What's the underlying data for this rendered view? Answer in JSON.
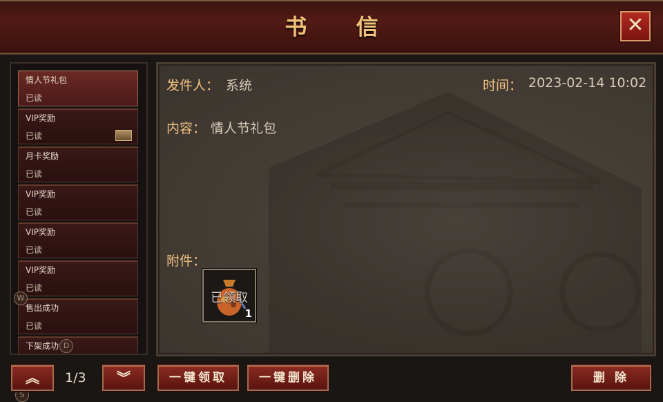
{
  "window": {
    "title": "书 信",
    "close_label": "✕"
  },
  "mail_list": [
    {
      "subject": "情人节礼包",
      "status": "已读",
      "selected": true,
      "has_attachment": false
    },
    {
      "subject": "VIP奖励",
      "status": "已读",
      "selected": false,
      "has_attachment": true
    },
    {
      "subject": "月卡奖励",
      "status": "已读",
      "selected": false,
      "has_attachment": false
    },
    {
      "subject": "VIP奖励",
      "status": "已读",
      "selected": false,
      "has_attachment": false
    },
    {
      "subject": "VIP奖励",
      "status": "已读",
      "selected": false,
      "has_attachment": false
    },
    {
      "subject": "VIP奖励",
      "status": "已读",
      "selected": false,
      "has_attachment": false
    },
    {
      "subject": "售出成功",
      "status": "已读",
      "selected": false,
      "has_attachment": false
    },
    {
      "subject": "下架成功",
      "status": "",
      "selected": false,
      "has_attachment": false
    }
  ],
  "badges": {
    "w": "W",
    "d": "D",
    "s": "S"
  },
  "detail": {
    "sender_label": "发件人：",
    "sender_value": "系统",
    "time_label": "时间：",
    "time_value": "2023-02-14 10:02",
    "content_label": "内容：",
    "content_value": "情人节礼包",
    "attachment_label": "附件："
  },
  "attachment": {
    "icon": "gift-bag-icon",
    "claimed_text": "已领取",
    "quantity": "1"
  },
  "pagination": {
    "text": "1/3",
    "up_icon": "chevron-up-icon",
    "down_icon": "chevron-down-icon"
  },
  "buttons": {
    "claim_all": "一键领取",
    "delete_all": "一键删除",
    "delete": "删 除"
  }
}
